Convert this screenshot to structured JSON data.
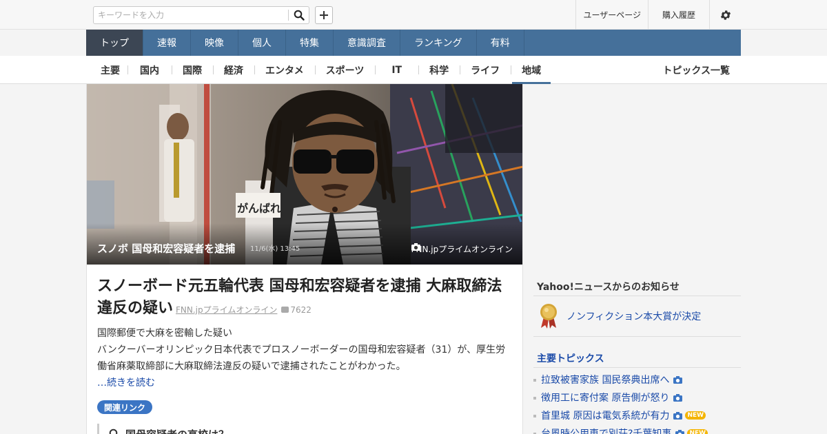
{
  "search": {
    "placeholder": "キーワードを入力"
  },
  "top_links": {
    "user_page": "ユーザーページ",
    "purchase_history": "購入履歴"
  },
  "main_nav": [
    "トップ",
    "速報",
    "映像",
    "個人",
    "特集",
    "意識調査",
    "ランキング",
    "有料"
  ],
  "sub_nav": [
    "主要",
    "国内",
    "国際",
    "経済",
    "エンタメ",
    "スポーツ",
    "IT",
    "科学",
    "ライフ",
    "地域"
  ],
  "topics_all": "トピックス一覧",
  "hero": {
    "title": "スノボ 国母和宏容疑者を逮捕",
    "time": "11/6(水) 13:45",
    "source": "FNN.jpプライムオンライン",
    "sign_text": "がんばれ"
  },
  "article": {
    "title": "スノーボード元五輪代表 国母和宏容疑者を逮捕 大麻取締法違反の疑い",
    "source": "FNN.jpプライムオンライン",
    "comments": "7622",
    "subtitle": "国際郵便で大麻を密輸した疑い",
    "body": "バンクーバーオリンピック日本代表でプロスノーボーダーの国母和宏容疑者（31）が、厚生労働省麻薬取締部に大麻取締法違反の疑いで逮捕されたことがわかった。",
    "read_more": "…続きを読む",
    "related_label": "関連リンク",
    "related_item": "国母容疑者の高校は？"
  },
  "notice": {
    "heading": "Yahoo!ニュースからのお知らせ",
    "item": "ノンフィクション本大賞が決定"
  },
  "topics": {
    "heading": "主要トピックス",
    "new_label": "NEW",
    "items": [
      {
        "text": "拉致被害家族 国民祭典出席へ",
        "camera": true,
        "new": false
      },
      {
        "text": "徴用工に寄付案 原告側が怒り",
        "camera": true,
        "new": false
      },
      {
        "text": "首里城 原因は電気系統が有力",
        "camera": true,
        "new": true
      },
      {
        "text": "台風時公用車で別荘?千葉知事",
        "camera": true,
        "new": true
      }
    ]
  },
  "colors": {
    "nav_bg": "#45709a",
    "nav_active": "#3c4654",
    "link": "#1a4aa8",
    "badge": "#3b75c4",
    "new_badge": "#f4b400"
  }
}
